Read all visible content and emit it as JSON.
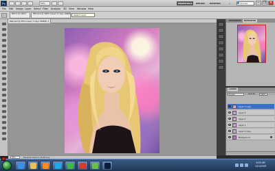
{
  "appbar": {
    "logo": "Ps",
    "zoom": "50%",
    "workspaces": [
      "ESSENTIALS",
      "DESIGN",
      "PAINTING"
    ],
    "more": "»",
    "cs_live": "CS Live",
    "win_minimize": "–",
    "win_restore": "❐",
    "win_close": "×"
  },
  "menu": [
    "File",
    "Edit",
    "Image",
    "Layer",
    "Select",
    "Filter",
    "Analysis",
    "3D",
    "View",
    "Window",
    "Help"
  ],
  "options": {
    "doc_tabs": [
      "PSD 4 @ 100%",
      "PSD psd @ 100% (Layer 3 copy, RGB/8)"
    ],
    "tooltip": "Select Layer"
  },
  "document": {
    "title": "Wall.psd @ 50% (Layer 3 copy, RGB/8) ×"
  },
  "status": {
    "zoom": "50%",
    "text": "Exposure works in 32-bit only"
  },
  "panels": {
    "navigator_tabs": [
      "HISTOGRAM",
      "NAVIGATOR"
    ],
    "layers_tabs": [
      "LAYERS"
    ],
    "blend_mode": "Screen",
    "opacity_label": "Opacity:",
    "opacity_value": "100%",
    "layers": [
      {
        "name": "Layer 3 copy",
        "selected": true
      },
      {
        "name": "Layer 3",
        "selected": false
      },
      {
        "name": "Layer 2",
        "selected": false
      },
      {
        "name": "Layer 1",
        "selected": false
      },
      {
        "name": "Layer 2 copy",
        "selected": false
      },
      {
        "name": "Background",
        "selected": false
      }
    ]
  },
  "taskbar": {
    "time": "4:05 AM",
    "date": "1/21/2009",
    "apps": [
      "ie-icon",
      "explorer-icon",
      "media-player-icon",
      "skype-icon",
      "messenger-icon",
      "chrome-icon",
      "utorrent-icon",
      "photoshop-icon"
    ]
  },
  "colors": {
    "foreground": "#cc1a1a",
    "background": "#ffffff",
    "selected_layer": "#3a71c6"
  }
}
